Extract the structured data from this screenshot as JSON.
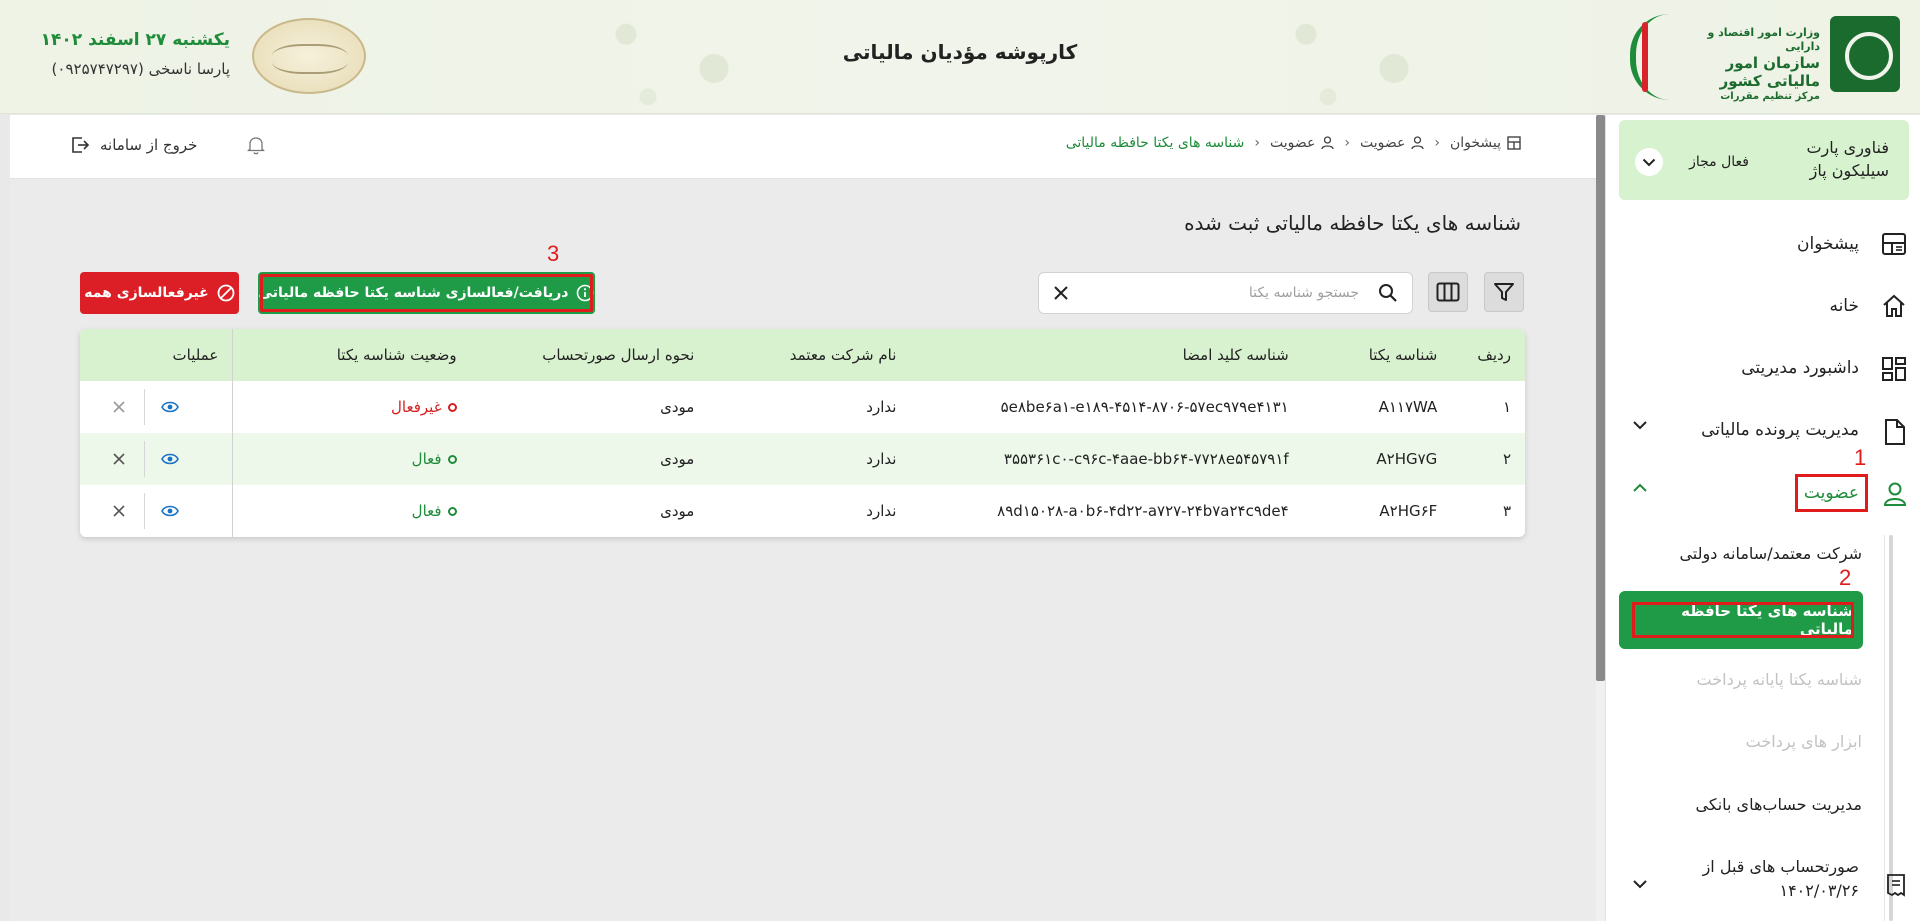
{
  "header": {
    "title": "کارپوشه مؤدیان مالیاتی",
    "date": "یکشنبه ۲۷ اسفند ۱۴۰۲",
    "user": "پارسا ناسخی (۰۹۲۵۷۴۷۲۹۷)",
    "seal_text": "مهار تورم، رشد تولید",
    "logo": {
      "line1": "وزارت امور اقتصاد و دارایی",
      "line2": "سازمان امور مالیاتی کشور",
      "line3": "مرکز تنظیم مقررات"
    }
  },
  "topbar": {
    "breadcrumb": [
      {
        "label": "پیشخوان",
        "icon": "dashboard-icon"
      },
      {
        "label": "عضویت",
        "icon": "user-icon"
      },
      {
        "label": "عضویت",
        "icon": "user-icon"
      },
      {
        "label": "شناسه های یکتا حافظه مالیاتی",
        "icon": ""
      }
    ],
    "logout_label": "خروج از سامانه"
  },
  "page": {
    "heading": "شناسه های یکتا حافظه مالیاتی ثبت شده",
    "search_placeholder": "جستجو شناسه یکتا",
    "activate_button": "دریافت/فعالسازی شناسه یکتا حافظه مالیاتی",
    "deactivate_all_button": "غیرفعالسازی همه",
    "annotations": [
      "1",
      "2",
      "3"
    ]
  },
  "table": {
    "headers": [
      "ردیف",
      "شناسه یکتا",
      "شناسه کلید امضا",
      "نام شرکت معتمد",
      "نحوه ارسال صورتحساب",
      "وضعیت شناسه یکتا",
      "عملیات"
    ],
    "rows": [
      {
        "index": "۱",
        "uid": "A۱۱۷WA",
        "key": "۵e۸be۶a۱-e۱۸۹-۴۵۱۴-۸۷۰۶-۵۷ec۹۷۹e۴۱۳۱",
        "company": "ندارد",
        "send_method": "مودی",
        "status": "غیرفعال",
        "status_type": "inactive"
      },
      {
        "index": "۲",
        "uid": "A۲HG۷G",
        "key": "۳۵۵۳۶۱c۰-c۹۶c-۴aae-bb۶۴-۷۷۲۸e۵۴۵۷۹۱f",
        "company": "ندارد",
        "send_method": "مودی",
        "status": "فعال",
        "status_type": "active"
      },
      {
        "index": "۳",
        "uid": "A۲HG۶F",
        "key": "۸۹d۱۵۰۲۸-a۰b۶-۴d۲۲-a۷۲۷-۲۴b۷a۲۴c۹de۴",
        "company": "ندارد",
        "send_method": "مودی",
        "status": "فعال",
        "status_type": "active"
      }
    ]
  },
  "sidebar": {
    "company": {
      "name_line1": "فناوری پارت",
      "name_line2": "سیلیکون پاژ",
      "status": "فعال مجاز"
    },
    "items": [
      {
        "label": "پیشخوان",
        "icon": "dashboard-icon"
      },
      {
        "label": "خانه",
        "icon": "home-icon"
      },
      {
        "label": "داشبورد مدیریتی",
        "icon": "grid-icon"
      },
      {
        "label": "مدیریت پرونده مالیاتی",
        "icon": "file-icon"
      },
      {
        "label": "عضویت",
        "icon": "user-icon"
      }
    ],
    "subitems": [
      {
        "label": "شرکت معتمد/سامانه دولتی",
        "disabled": false
      },
      {
        "label": "شناسه های یکتا حافظه مالیاتی",
        "active": true
      },
      {
        "label": "شناسه یکتا پایانه پرداخت",
        "disabled": true
      },
      {
        "label": "ابزار های پرداخت",
        "disabled": true
      },
      {
        "label": "مدیریت حساب‌های بانکی",
        "disabled": false
      }
    ],
    "last_item": {
      "line1": "صورتحساب های قبل از",
      "line2": "۱۴۰۲/۰۳/۲۶",
      "icon": "receipt-icon"
    }
  },
  "colors": {
    "brand_green": "#1f9b48",
    "danger_red": "#dc1f26",
    "annotation_red": "#e01b1b",
    "header_row": "#d8f2cf"
  }
}
